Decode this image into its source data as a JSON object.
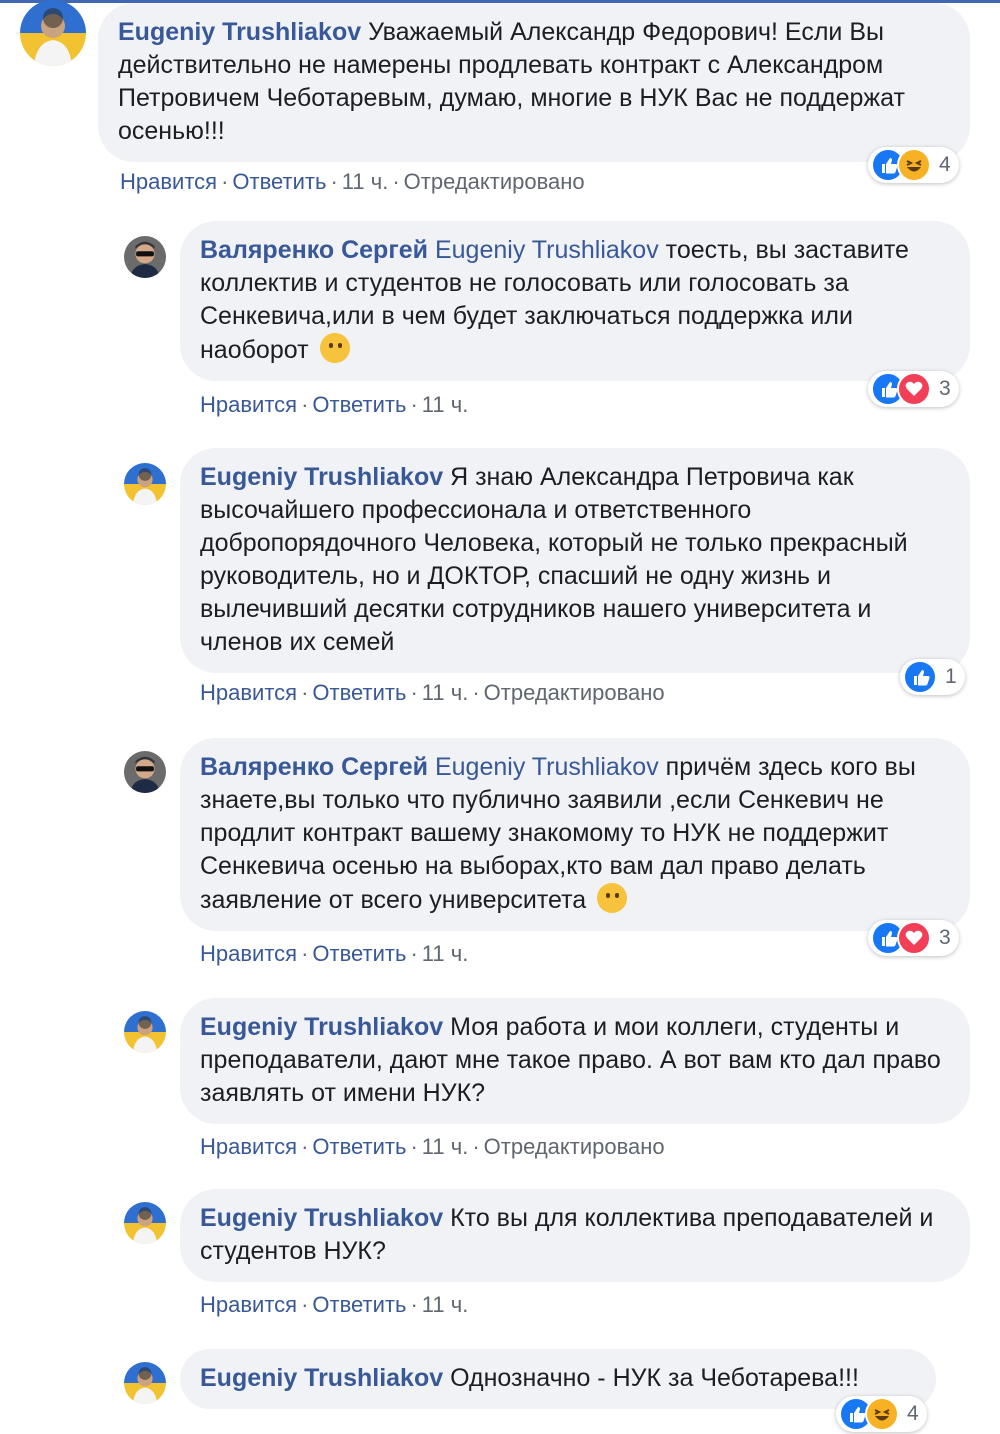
{
  "actions": {
    "like": "Нравится",
    "reply": "Ответить",
    "edited": "Отредактировано",
    "separator": "·"
  },
  "comments": [
    {
      "author": "Eugeniy Trushliakov",
      "tag": "",
      "text": "Уважаемый Александр Федорович! Если Вы действительно не намерены продлевать контракт с Александром Петровичем Чеботаревым, думаю, многие в НУК Вас не поддержат осенью!!!",
      "emoji": "",
      "time": "11 ч.",
      "edited": true,
      "reactions": {
        "types": [
          "like",
          "haha"
        ],
        "count": "4"
      }
    },
    {
      "author": "Валяренко Сергей",
      "tag": "Eugeniy Trushliakov",
      "text": "тоесть, вы заставите коллектив и студентов не голосовать или голосовать за Сенкевича,или в чем будет заключаться поддержка или наоборот",
      "emoji": "thinking-face",
      "time": "11 ч.",
      "edited": false,
      "reactions": {
        "types": [
          "like",
          "love"
        ],
        "count": "3"
      }
    },
    {
      "author": "Eugeniy Trushliakov",
      "tag": "",
      "text": "Я знаю Александра Петровича как высочайшего профессионала и ответственного добропорядочного Человека, который не только прекрасный руководитель, но и ДОКТОР, спасший не одну жизнь и вылечивший десятки сотрудников нашего университета и членов их семей",
      "emoji": "",
      "time": "11 ч.",
      "edited": true,
      "reactions": {
        "types": [
          "like"
        ],
        "count": "1"
      }
    },
    {
      "author": "Валяренко Сергей",
      "tag": "Eugeniy Trushliakov",
      "text": "причём здесь кого вы знаете,вы только что публично заявили ,если Сенкевич не продлит контракт вашему знакомому то НУК не поддержит Сенкевича осенью на выборах,кто вам дал право делать заявление от всего университета",
      "emoji": "thinking-face",
      "time": "11 ч.",
      "edited": false,
      "reactions": {
        "types": [
          "like",
          "love"
        ],
        "count": "3"
      }
    },
    {
      "author": "Eugeniy Trushliakov",
      "tag": "",
      "text": "Моя работа и мои коллеги, студенты и преподаватели, дают мне такое право. А вот вам кто дал право заявлять от имени НУК?",
      "emoji": "",
      "time": "11 ч.",
      "edited": true,
      "reactions": null
    },
    {
      "author": "Eugeniy Trushliakov",
      "tag": "",
      "text": "Кто вы для коллектива преподавателей и студентов НУК?",
      "emoji": "",
      "time": "11 ч.",
      "edited": false,
      "reactions": null
    },
    {
      "author": "Eugeniy Trushliakov",
      "tag": "",
      "text": "Однозначно - НУК за Чеботарева!!!",
      "emoji": "",
      "time": "",
      "edited": false,
      "reactions": {
        "types": [
          "like",
          "haha"
        ],
        "count": "4"
      }
    }
  ]
}
